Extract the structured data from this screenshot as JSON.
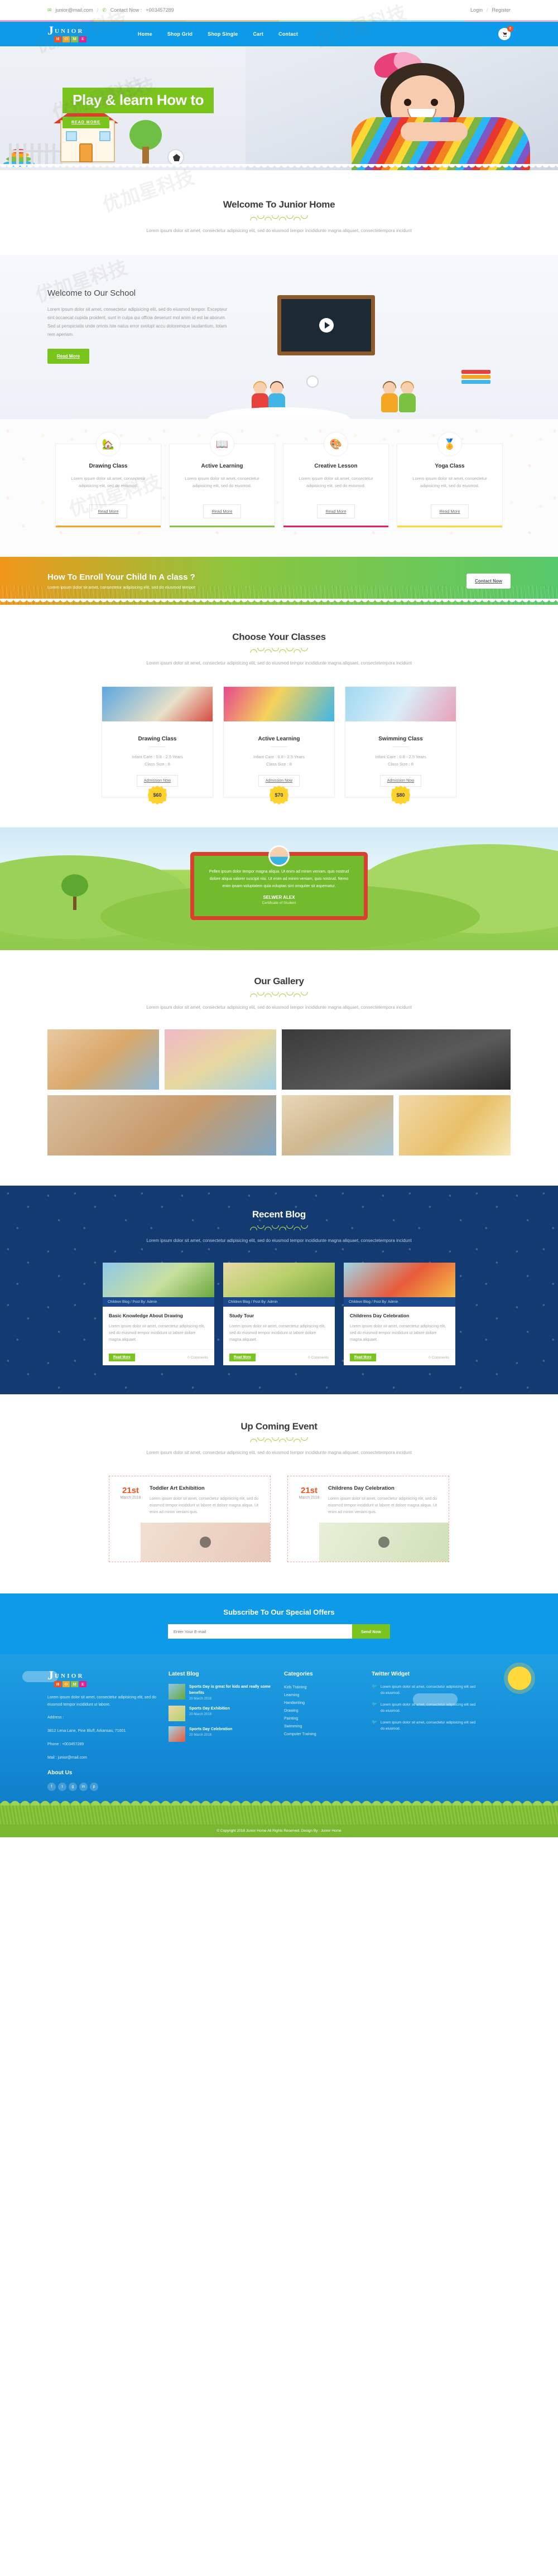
{
  "topbar": {
    "email": "junior@mail.com",
    "separator": "/",
    "contact_label": "Contact Now :",
    "phone": "+003457289",
    "login": "Login",
    "register": "Register",
    "mail_icon": "✉",
    "phone_icon": "✆"
  },
  "nav": {
    "logo_j": "J",
    "logo_word": "UNIOR",
    "logo_blocks": [
      {
        "letter": "H",
        "color": "#f4511e"
      },
      {
        "letter": "O",
        "color": "#f5a623"
      },
      {
        "letter": "M",
        "color": "#8bc34a"
      },
      {
        "letter": "E",
        "color": "#e91e8c"
      }
    ],
    "menu": [
      "Home",
      "Shop Grid",
      "Shop Single",
      "Cart",
      "Contact"
    ],
    "cart_icon": "cart-icon",
    "cart_count": "0"
  },
  "hero": {
    "title": "Play & learn How to",
    "button": "READ MORE"
  },
  "welcome": {
    "title": "Welcome To Junior Home",
    "subtitle": "Lorem ipsum dolor sit amet, consectetur adipisicing elit, sed do eiusmod tempor incididunte magna aliquaet, consectetempora incidunt"
  },
  "school": {
    "title": "Welcome to Our School",
    "paragraph": "Lorem ipsum dolor sit amet, consectetur adipisicing elit, sed do eiusmod tempor. Excepteur sint occaecat cupida proident, sunt in culpa qui officia deserunt mol anim id est lai aborum. Sed ut perspiciatis unde omnis iste natus error svolupt accu doloremque laudantium, totam rem aperiam.",
    "button": "Read More"
  },
  "features": {
    "cards": [
      {
        "icon": "🏡",
        "icon_name": "house-tree-icon",
        "title": "Drawing Class",
        "text": "Lorem ipsum dolor sit amet, consectetur adipisicing elit, sed do eiusmod.",
        "button": "Read More",
        "accent": "#f5a623"
      },
      {
        "icon": "📖",
        "icon_name": "open-book-icon",
        "title": "Active Learning",
        "text": "Lorem ipsum dolor sit amet, consectetur adipisicing elit, sed do eiusmod.",
        "button": "Read More",
        "accent": "#8bc34a"
      },
      {
        "icon": "🎨",
        "icon_name": "palette-icon",
        "title": "Creative Lesson",
        "text": "Lorem ipsum dolor sit amet, consectetur adipisicing elit, sed do eiusmod.",
        "button": "Read More",
        "accent": "#e91e63"
      },
      {
        "icon": "🏅",
        "icon_name": "award-person-icon",
        "title": "Yoga Class",
        "text": "Lorem ipsum dolor sit amet, consectetur adipisicing elit, sed do eiusmod.",
        "button": "Read More",
        "accent": "#fdd835"
      }
    ]
  },
  "enroll": {
    "title": "How To Enroll Your Child In A class ?",
    "text": "Lorem ipsum dolor sit amet, consectetur adipisicing elit, sed do eiusmod tempor",
    "button": "Contact Now"
  },
  "classes": {
    "title": "Choose Your Classes",
    "subtitle": "Lorem ipsum dolor sit amet, consectetur adipisicing elit, sed do eiusmod tempor incididunte magna aliquaet, consectetempora incidunt",
    "cards": [
      {
        "price": "$60",
        "title": "Drawing Class",
        "age": "Infant Care : 0.8 - 2.5 Years",
        "size": "Class Size : 8",
        "button": "Admission Now"
      },
      {
        "price": "$70",
        "title": "Active Learning",
        "age": "Infant Care : 0.8 - 2.5 Years",
        "size": "Class Size : 8",
        "button": "Admission Now"
      },
      {
        "price": "$80",
        "title": "Swimming Class",
        "age": "Infant Care : 0.8 - 2.5 Years",
        "size": "Class Size : 8",
        "button": "Admission Now"
      }
    ]
  },
  "testimonial": {
    "quote": "Pellen ipsum dolor tempor magna aliqua. Ut enim ad minim veniam, quis nostrud dolore aliqua valorer suscipit nisi. Ut enim ad minim veniam, quis nostrud. Nemo enim ipsam voluptatem quia voluptas sint omquiter sit aspernatur.",
    "name": "SELWER ALEX",
    "role": "Certificate of Student"
  },
  "gallery": {
    "title": "Our Gallery",
    "subtitle": "Lorem ipsum dolor sit amet, consectetur adipisicing elit, sed do eiusmod tempor incididunte magna aliquaet, consectetempora incidunt"
  },
  "blog": {
    "title": "Recent Blog",
    "subtitle": "Lorem ipsum dolor sit amet, consectetur adipisicing elit, sed do eiusmod tempor incididunte magna aliquaet, consectetempora incidunt",
    "cards": [
      {
        "meta": "Children Blog / Post By: Admin",
        "title": "Basic Knowledge About Drawing",
        "text": "Lorem ipsum dolor sit amet, consectetur adipisicing elit, sed do eiusmod tempor incididunt ut labore dolore magna aliquaet.",
        "more": "Read More",
        "comments": "0 Comments"
      },
      {
        "meta": "Children Blog / Post By: Admin",
        "title": "Study Tour",
        "text": "Lorem ipsum dolor sit amet, consectetur adipisicing elit, sed do eiusmod tempor incididunt ut labore dolore magna aliquaet.",
        "more": "Read More",
        "comments": "0 Comments"
      },
      {
        "meta": "Children Blog / Post By: Admin",
        "title": "Childrens Day Celebration",
        "text": "Lorem ipsum dolor sit amet, consectetur adipisicing elit, sed do eiusmod tempor incididunt ut labore dolore magna aliquaet.",
        "more": "Read More",
        "comments": "0 Comments"
      }
    ]
  },
  "events": {
    "title": "Up Coming Event",
    "subtitle": "Lorem ipsum dolor sit amet, consectetur adipisicing elit, sed do eiusmod tempor incididunte magna aliquaet, consectetempora incidunt",
    "cards": [
      {
        "day": "21st",
        "month": "March 2018",
        "title": "Toddler Art Exhibition",
        "text": "Lorem ipsum dolor sit amet, consectetur adipisicing elit, sed do eiusmod tempor incididunt ut labore et dolore magna aliqua. Ut enim ad minim veniam quis."
      },
      {
        "day": "21st",
        "month": "March 2018",
        "title": "Childrens Day Celebration",
        "text": "Lorem ipsum dolor sit amet, consectetur adipisicing elit, sed do eiusmod tempor incididunt ut labore et dolore magna aliqua. Ut enim ad minim veniam quis."
      }
    ]
  },
  "subscribe": {
    "title": "Subscribe To Our Special Offers",
    "placeholder": "Enter Your E-mail",
    "button": "Send Now"
  },
  "footer": {
    "logo_j": "J",
    "logo_word": "UNIOR",
    "logo_blocks": [
      {
        "letter": "H",
        "color": "#f4511e"
      },
      {
        "letter": "O",
        "color": "#f5a623"
      },
      {
        "letter": "M",
        "color": "#8bc34a"
      },
      {
        "letter": "E",
        "color": "#e91e8c"
      }
    ],
    "about_text": "Lorem ipsum dolor sit amet, consectetur adipisicing elit, sed do eiusmod tempor incididunt ut labore.",
    "address_label": "Address :",
    "address": "3812 Lena Lane, Pine Bluff,\nArkansas, 71601",
    "phone_label": "Phone : +003457289",
    "mail_label": "Mail : junior@mail.com",
    "about_heading": "About Us",
    "socials": [
      "f",
      "t",
      "g",
      "in",
      "p"
    ],
    "latest_blog_heading": "Latest Blog",
    "latest_blog": [
      {
        "title": "Sports Day is great for kids and really some benefits",
        "date": "20 March 2018"
      },
      {
        "title": "Sports Day Exhibition",
        "date": "20 March 2018"
      },
      {
        "title": "Sports Day Celebration",
        "date": "20 March 2018"
      }
    ],
    "categories_heading": "Categories",
    "categories": [
      "Kids Training",
      "Learning",
      "Handwriting",
      "Drawing",
      "Painting",
      "Swimming",
      "Computer Training"
    ],
    "twitter_heading": "Twitter Widget",
    "tweets": [
      {
        "text": "Lorem ipsum dolor sit amet, consectetur adipisicing elit sed do eiusmod."
      },
      {
        "text": "Lorem ipsum dolor sit amet, consectetur adipisicing elit sed do eiusmod."
      },
      {
        "text": "Lorem ipsum dolor sit amet, consectetur adipisicing elit sed do eiusmod."
      }
    ],
    "copyright": "© Copyright 2018 Junior Home All Rights Reserved. Design By : Junior Home"
  },
  "watermark": "优加星科技"
}
